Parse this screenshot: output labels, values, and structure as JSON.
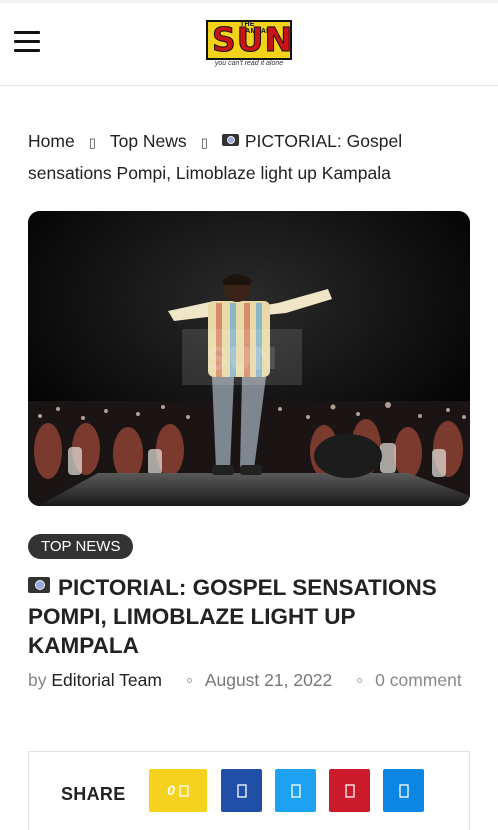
{
  "header": {
    "logo": {
      "kicker": "THE KAMPALA",
      "word": "SUN",
      "tagline": "you can't read it alone"
    }
  },
  "breadcrumb": {
    "home": "Home",
    "category": "Top News",
    "current": "PICTORIAL: Gospel sensations Pompi, Limoblaze light up Kampala"
  },
  "article": {
    "category_badge": "TOP NEWS",
    "title": "PICTORIAL: GOSPEL SENSATIONS POMPI, LIMOBLAZE LIGHT UP KAMPALA",
    "author_prefix": "by",
    "author": "Editorial Team",
    "date": "August 21, 2022",
    "comments": "0 comment"
  },
  "share": {
    "label": "SHARE",
    "count": "0",
    "buttons": [
      {
        "name": "share-count",
        "color": "#f5d21e"
      },
      {
        "name": "facebook",
        "color": "#1f4fa6"
      },
      {
        "name": "twitter",
        "color": "#1da1f2"
      },
      {
        "name": "pinterest",
        "color": "#cb1b2a"
      },
      {
        "name": "telegram",
        "color": "#0b87e3"
      }
    ]
  },
  "colors": {
    "badge_bg": "#333333",
    "logo_yellow": "#f2d21b",
    "logo_red": "#c81414"
  }
}
